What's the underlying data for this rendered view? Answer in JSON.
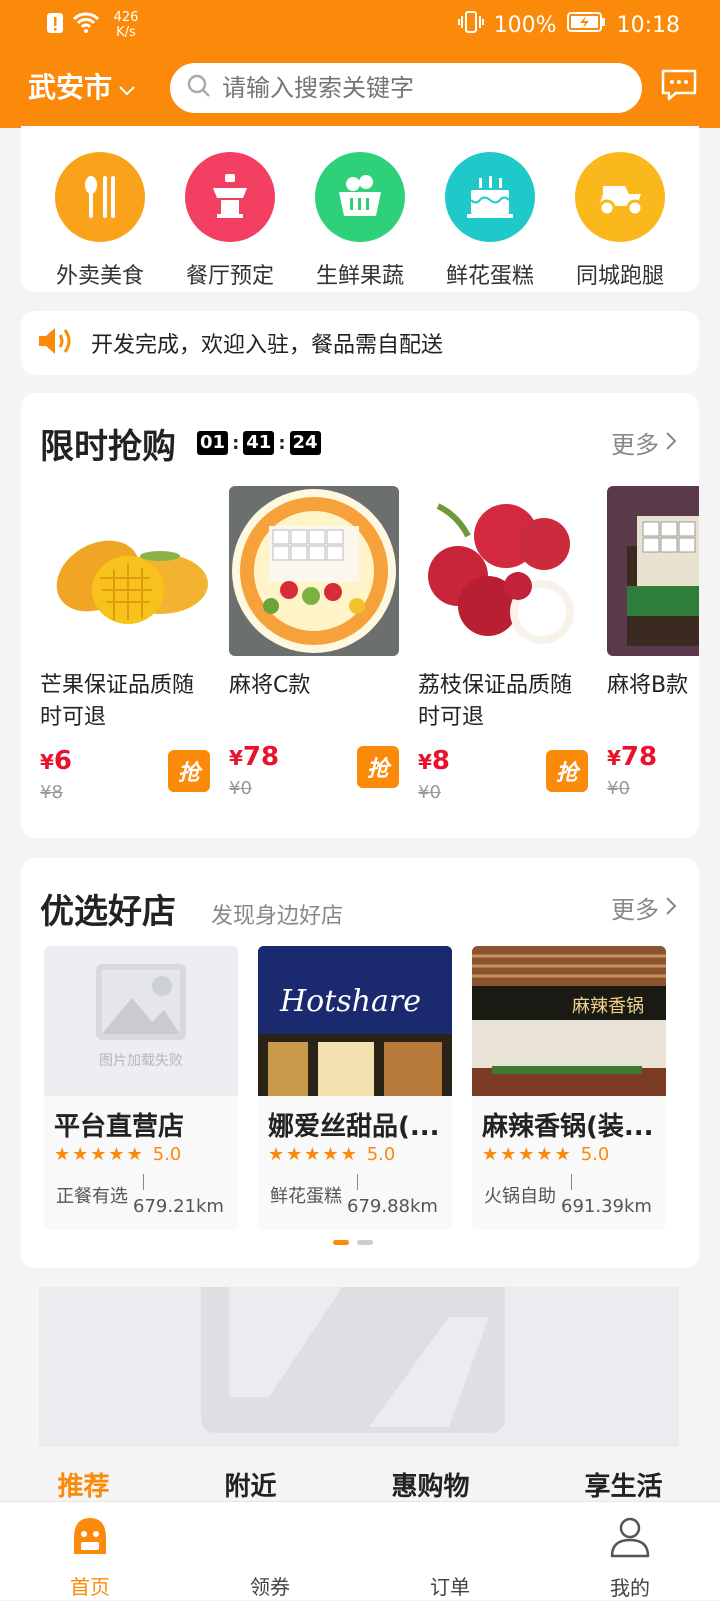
{
  "status": {
    "speed_value": "426",
    "speed_unit": "K/s",
    "battery": "100%",
    "time": "10:18"
  },
  "header": {
    "city": "武安市",
    "search_placeholder": "请输入搜索关键字"
  },
  "categories": [
    {
      "label": "外卖美食",
      "icon": "utensils-icon",
      "color": "#f9a21a"
    },
    {
      "label": "餐厅预定",
      "icon": "dining-table-icon",
      "color": "#f23f62"
    },
    {
      "label": "生鲜果蔬",
      "icon": "fruit-basket-icon",
      "color": "#2fd07a"
    },
    {
      "label": "鲜花蛋糕",
      "icon": "birthday-cake-icon",
      "color": "#1fc9c9"
    },
    {
      "label": "同城跑腿",
      "icon": "scooter-icon",
      "color": "#fbb81c"
    }
  ],
  "notice": {
    "text": "开发完成，欢迎入驻，餐品需自配送",
    "icon": "speaker-icon"
  },
  "flash_sale": {
    "title": "限时抢购",
    "countdown": {
      "h": "01",
      "m": "41",
      "s": "24"
    },
    "more": "更多",
    "grab_label": "抢",
    "currency": "¥",
    "products": [
      {
        "name": "芒果保证品质随时可退",
        "price": "6",
        "old_price": "¥8"
      },
      {
        "name": "麻将C款",
        "price": "78",
        "old_price": "¥0"
      },
      {
        "name": "荔枝保证品质随时可退",
        "price": "8",
        "old_price": "¥0"
      },
      {
        "name": "麻将B款",
        "price": "78",
        "old_price": "¥0"
      }
    ]
  },
  "shops": {
    "title": "优选好店",
    "subtitle": "发现身边好店",
    "more": "更多",
    "img_failed_text": "图片加载失败",
    "items": [
      {
        "name": "平台直营店",
        "rating": "5.0",
        "category": "正餐有选",
        "distance": "679.21km"
      },
      {
        "name": "娜爱丝甜品(...",
        "rating": "5.0",
        "category": "鲜花蛋糕",
        "distance": "679.88km",
        "sign": "Hotshare"
      },
      {
        "name": "麻辣香锅(装...",
        "rating": "5.0",
        "category": "火锅自助",
        "distance": "691.39km",
        "sign": "麻辣香锅"
      }
    ]
  },
  "tabs_peek": [
    "推荐",
    "附近",
    "惠购物",
    "享生活"
  ],
  "bottom_nav": [
    {
      "label": "首页",
      "icon": "home-mascot-icon"
    },
    {
      "label": "领券",
      "icon": "coupon-icon"
    },
    {
      "label": "订单",
      "icon": "order-icon"
    },
    {
      "label": "我的",
      "icon": "user-icon"
    }
  ],
  "colors": {
    "brand": "#fb8a0a",
    "price": "#e8132b"
  }
}
